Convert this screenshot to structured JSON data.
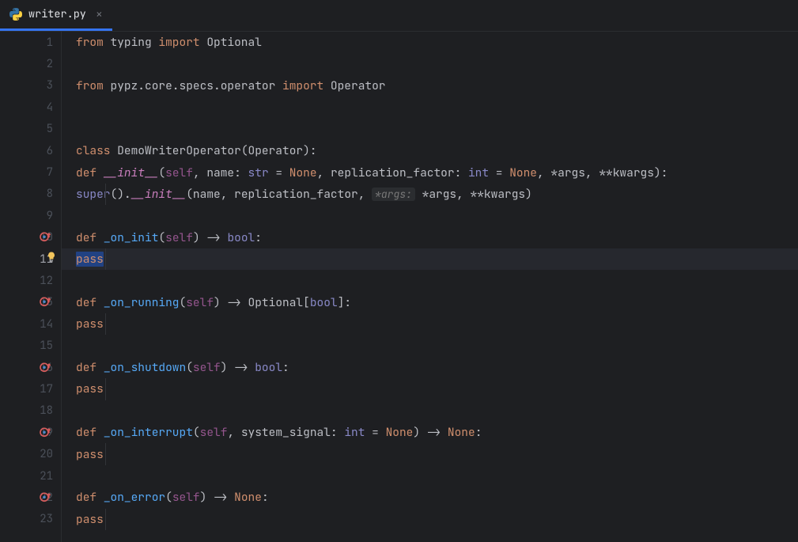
{
  "tab": {
    "title": "writer.py",
    "close_label": "×"
  },
  "gutter": {
    "line_numbers": [
      "1",
      "2",
      "3",
      "4",
      "5",
      "6",
      "7",
      "8",
      "9",
      "10",
      "11",
      "12",
      "13",
      "14",
      "15",
      "16",
      "17",
      "18",
      "19",
      "20",
      "21",
      "22",
      "23"
    ]
  },
  "code": {
    "l1": {
      "kw1": "from ",
      "mod": "typing ",
      "kw2": "import ",
      "name": "Optional"
    },
    "l3": {
      "kw1": "from ",
      "mod": "pypz.core.specs.operator ",
      "kw2": "import ",
      "name": "Operator"
    },
    "l6": {
      "kw": "class ",
      "name": "DemoWriterOperator",
      "paren": "(Operator):"
    },
    "l7": {
      "kw": "def ",
      "fn": "__init__",
      "sig_a": "(",
      "self": "self",
      "sig_b": ", name: ",
      "t1": "str",
      "eq1": " = ",
      "n1": "None",
      "sig_c": ", replication_factor: ",
      "t2": "int",
      "eq2": " = ",
      "n2": "None",
      "sig_d": ", *args, **kwargs):"
    },
    "l8": {
      "call_a": "super",
      "call_b": "().",
      "fn": "__init__",
      "call_c": "(name, replication_factor, ",
      "hint": "*args:",
      "call_d": " *args, **kwargs)"
    },
    "l10": {
      "kw": "def ",
      "fn": "_on_init",
      "sig_a": "(",
      "self": "self",
      "sig_b": ") -> ",
      "ret": "bool",
      "sig_c": ":"
    },
    "l11": {
      "kw": "pass"
    },
    "l13": {
      "kw": "def ",
      "fn": "_on_running",
      "sig_a": "(",
      "self": "self",
      "sig_b": ") -> Optional[",
      "ret": "bool",
      "sig_c": "]:"
    },
    "l14": {
      "kw": "pass"
    },
    "l16": {
      "kw": "def ",
      "fn": "_on_shutdown",
      "sig_a": "(",
      "self": "self",
      "sig_b": ") -> ",
      "ret": "bool",
      "sig_c": ":"
    },
    "l17": {
      "kw": "pass"
    },
    "l19": {
      "kw": "def ",
      "fn": "_on_interrupt",
      "sig_a": "(",
      "self": "self",
      "sig_b": ", system_signal: ",
      "t1": "int",
      "eq1": " = ",
      "n1": "None",
      "sig_c": ") -> ",
      "ret": "None",
      "sig_d": ":"
    },
    "l20": {
      "kw": "pass"
    },
    "l22": {
      "kw": "def ",
      "fn": "_on_error",
      "sig_a": "(",
      "self": "self",
      "sig_b": ") -> ",
      "ret": "None",
      "sig_c": ":"
    },
    "l23": {
      "kw": "pass"
    }
  },
  "marks": {
    "override_lines": [
      10,
      13,
      16,
      19,
      22
    ],
    "bulb_line": 11,
    "highlight_line": 11,
    "active_line": 11
  }
}
